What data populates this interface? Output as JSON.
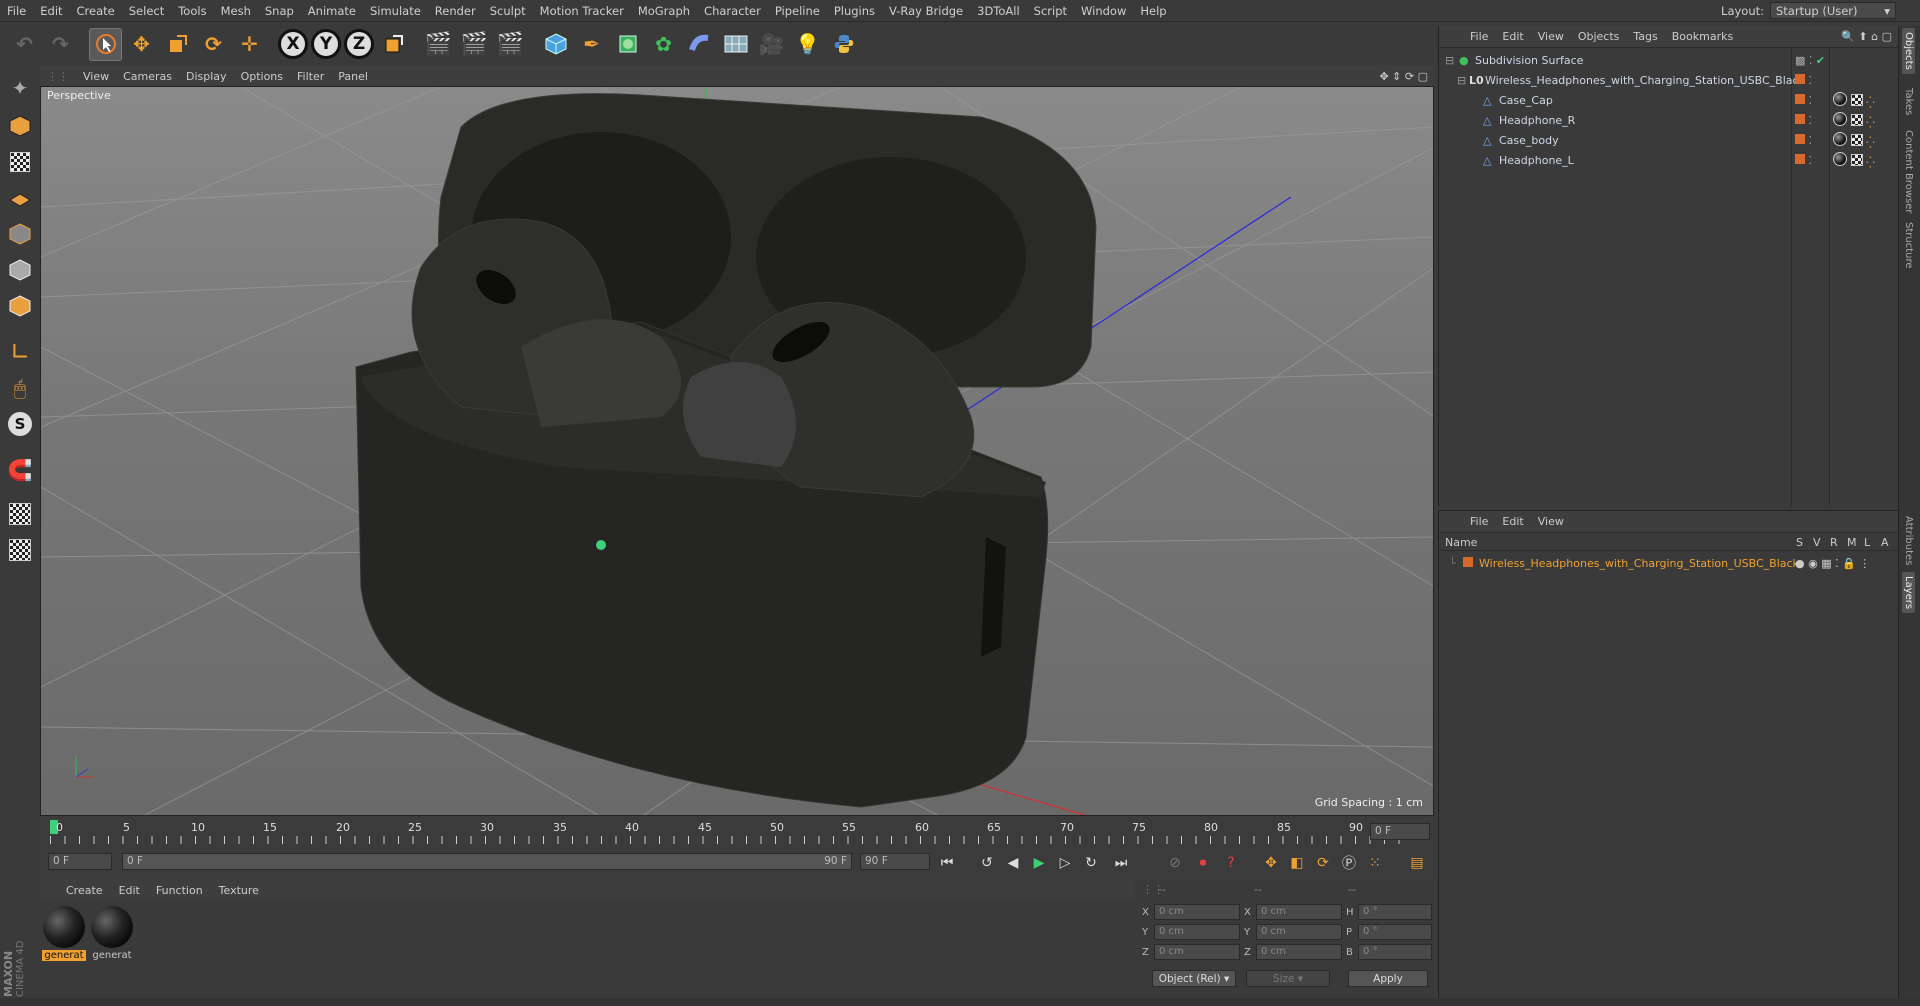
{
  "menubar": {
    "items": [
      "File",
      "Edit",
      "Create",
      "Select",
      "Tools",
      "Mesh",
      "Snap",
      "Animate",
      "Simulate",
      "Render",
      "Sculpt",
      "Motion Tracker",
      "MoGraph",
      "Character",
      "Pipeline",
      "Plugins",
      "V-Ray Bridge",
      "3DToAll",
      "Script",
      "Window",
      "Help"
    ],
    "layout_label": "Layout:",
    "layout_value": "Startup (User)"
  },
  "toolbar": {
    "axis_x": "X",
    "axis_y": "Y",
    "axis_z": "Z"
  },
  "viewport": {
    "menu": [
      "View",
      "Cameras",
      "Display",
      "Options",
      "Filter",
      "Panel"
    ],
    "label": "Perspective",
    "grid_spacing": "Grid Spacing : 1 cm"
  },
  "timeline": {
    "ticks": [
      "0",
      "5",
      "10",
      "15",
      "20",
      "25",
      "30",
      "35",
      "40",
      "45",
      "50",
      "55",
      "60",
      "65",
      "70",
      "75",
      "80",
      "85",
      "90"
    ],
    "current_frame": "0 F"
  },
  "playbar": {
    "start_field": "0 F",
    "range_start": "0 F",
    "range_end": "90 F",
    "end_field": "90 F"
  },
  "material_manager": {
    "menu": [
      "Create",
      "Edit",
      "Function",
      "Texture"
    ],
    "materials": [
      {
        "label": "generat",
        "selected": true
      },
      {
        "label": "generat",
        "selected": false
      }
    ]
  },
  "coordinates": {
    "header_dashes": [
      "--",
      "--",
      "--"
    ],
    "rows": [
      {
        "ax1": "X",
        "v1": "0 cm",
        "ax2": "X",
        "v2": "0 cm",
        "ax3": "H",
        "v3": "0 °"
      },
      {
        "ax1": "Y",
        "v1": "0 cm",
        "ax2": "Y",
        "v2": "0 cm",
        "ax3": "P",
        "v3": "0 °"
      },
      {
        "ax1": "Z",
        "v1": "0 cm",
        "ax2": "Z",
        "v2": "0 cm",
        "ax3": "B",
        "v3": "0 °"
      }
    ],
    "mode_select": "Object (Rel)",
    "size_select": "Size",
    "apply_label": "Apply"
  },
  "object_manager": {
    "menu": [
      "File",
      "Edit",
      "View",
      "Objects",
      "Tags",
      "Bookmarks"
    ],
    "objects": [
      {
        "name": "Subdivision Surface"
      },
      {
        "name": "Wireless_Headphones_with_Charging_Station_USBC_Black"
      },
      {
        "name": "Case_Cap"
      },
      {
        "name": "Headphone_R"
      },
      {
        "name": "Case_body"
      },
      {
        "name": "Headphone_L"
      }
    ]
  },
  "layer_manager": {
    "menu": [
      "File",
      "Edit",
      "View"
    ],
    "header_name": "Name",
    "header_cols": [
      "S",
      "V",
      "R",
      "M",
      "L",
      "A"
    ],
    "layers": [
      {
        "name": "Wireless_Headphones_with_Charging_Station_USBC_Black",
        "color": "#d76a2a"
      }
    ]
  },
  "side_tabs": [
    "Objects",
    "Takes",
    "Content Browser",
    "Structure",
    "Attributes",
    "Layers"
  ],
  "brand": {
    "logo_text": "MAXON CINEMA 4D"
  },
  "colors": {
    "accent_orange": "#f0a030",
    "selection_green": "#3fd07a",
    "layer_orange": "#d76a2a"
  }
}
